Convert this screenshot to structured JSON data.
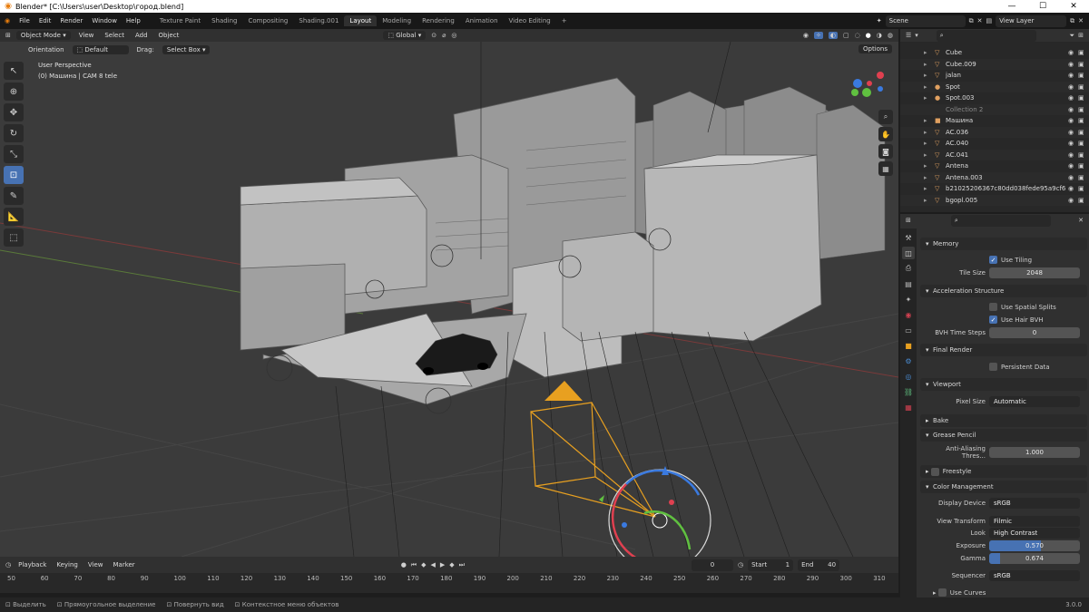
{
  "titlebar": {
    "title": "Blender* [C:\\Users\\user\\Desktop\\город.blend]",
    "minimize": "—",
    "maximize": "☐",
    "close": "✕"
  },
  "menubar": {
    "menus": [
      "File",
      "Edit",
      "Render",
      "Window",
      "Help"
    ],
    "workspaces": [
      "Texture Paint",
      "Shading",
      "Compositing",
      "Shading.001",
      "Layout",
      "Modeling",
      "Rendering",
      "Animation",
      "Video Editing"
    ],
    "add_tab": "+",
    "scene": "Scene",
    "view_layer": "View Layer"
  },
  "viewport_header": {
    "mode": "Object Mode",
    "menus": [
      "View",
      "Select",
      "Add",
      "Object"
    ],
    "transform": "Global",
    "orientation_label": "Orientation",
    "orientation_value": "Default",
    "drag_label": "Drag:",
    "drag_value": "Select Box",
    "options": "Options"
  },
  "viewport": {
    "perspective": "User Perspective",
    "object_info": "(0) Машина | CAM 8 tele"
  },
  "outliner": {
    "items": [
      {
        "name": "Cube",
        "icon": "▽",
        "color": "#e0a060"
      },
      {
        "name": "Cube.009",
        "icon": "▽",
        "color": "#e0a060"
      },
      {
        "name": "jalan",
        "icon": "▽",
        "color": "#e0a060"
      },
      {
        "name": "Spot",
        "icon": "●",
        "color": "#e0a060"
      },
      {
        "name": "Spot.003",
        "icon": "●",
        "color": "#e0a060"
      },
      {
        "name": "Collection 2",
        "icon": "",
        "color": "#888888"
      },
      {
        "name": "Машина",
        "icon": "■",
        "color": "#e0a060"
      },
      {
        "name": "AC.036",
        "icon": "▽",
        "color": "#e0a060"
      },
      {
        "name": "AC.040",
        "icon": "▽",
        "color": "#e0a060"
      },
      {
        "name": "AC.041",
        "icon": "▽",
        "color": "#e0a060"
      },
      {
        "name": "Antena",
        "icon": "▽",
        "color": "#e0a060"
      },
      {
        "name": "Antena.003",
        "icon": "▽",
        "color": "#e0a060"
      },
      {
        "name": "b21025206367c80dd038fede95a9cf6",
        "icon": "▽",
        "color": "#e0a060"
      },
      {
        "name": "bgopl.005",
        "icon": "▽",
        "color": "#e0a060"
      }
    ]
  },
  "properties": {
    "memory": "Memory",
    "use_tiling": "Use Tiling",
    "tile_size_label": "Tile Size",
    "tile_size": "2048",
    "accel": "Acceleration Structure",
    "spatial_splits": "Use Spatial Splits",
    "hair_bvh": "Use Hair BVH",
    "bvh_label": "BVH Time Steps",
    "bvh_value": "0",
    "final_render": "Final Render",
    "persistent": "Persistent Data",
    "viewport": "Viewport",
    "pixel_size_label": "Pixel Size",
    "pixel_size": "Automatic",
    "bake": "Bake",
    "grease": "Grease Pencil",
    "aa_label": "Anti-Aliasing Thres...",
    "aa_value": "1.000",
    "freestyle": "Freestyle",
    "color_mgmt": "Color Management",
    "display_label": "Display Device",
    "display_value": "sRGB",
    "view_label": "View Transform",
    "view_value": "Filmic",
    "look_label": "Look",
    "look_value": "High Contrast",
    "exposure_label": "Exposure",
    "exposure_value": "0.570",
    "exposure_fill": 0.57,
    "gamma_label": "Gamma",
    "gamma_value": "0.674",
    "gamma_fill": 0.12,
    "sequencer_label": "Sequencer",
    "sequencer_value": "sRGB",
    "curves": "Use Curves"
  },
  "timeline": {
    "menus": [
      "Playback",
      "Keying",
      "View",
      "Marker"
    ],
    "current": "0",
    "start_label": "Start",
    "start": "1",
    "end_label": "End",
    "end": "40",
    "ticks": [
      "50",
      "60",
      "70",
      "80",
      "90",
      "100",
      "110",
      "120",
      "130",
      "140",
      "150",
      "160",
      "170",
      "180",
      "190",
      "200",
      "210",
      "220",
      "230",
      "240",
      "250",
      "260",
      "270",
      "280",
      "290",
      "300",
      "310"
    ]
  },
  "statusbar": {
    "select": "Выделить",
    "box": "Прямоугольное выделение",
    "rotate": "Повернуть вид",
    "context": "Контекстное меню объектов",
    "version": "3.0.0"
  },
  "colors": {
    "accent": "#4772b3",
    "camera": "#e8a020"
  }
}
